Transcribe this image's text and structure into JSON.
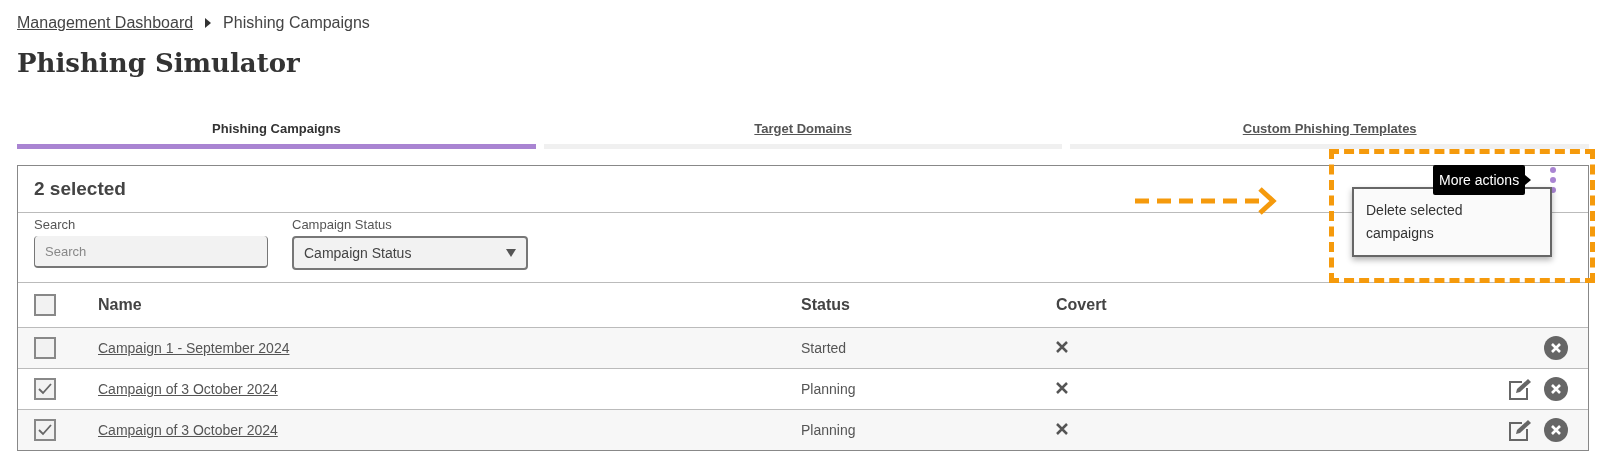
{
  "breadcrumb": [
    {
      "label": "Management Dashboard",
      "link": true
    },
    {
      "label": "Phishing Campaigns",
      "link": false
    }
  ],
  "title": "Phishing Simulator",
  "tabs": [
    {
      "label": "Phishing Campaigns",
      "selected": true
    },
    {
      "label": "Target Domains",
      "selected": false
    },
    {
      "label": "Custom Phishing Templates",
      "selected": false
    }
  ],
  "selection_summary": "2 selected",
  "more_actions": {
    "tooltip": "More actions",
    "menu_items": [
      "Delete selected campaigns"
    ]
  },
  "filters": {
    "search": {
      "label": "Search",
      "placeholder": "Search"
    },
    "status": {
      "label": "Campaign Status",
      "value": "Campaign Status"
    }
  },
  "table": {
    "select_all_checked": false,
    "columns": [
      "Name",
      "Status",
      "Covert"
    ],
    "rows": [
      {
        "checked": false,
        "name": "Campaign 1 - September 2024",
        "status": "Started",
        "covert": false,
        "editable": false
      },
      {
        "checked": true,
        "name": "Campaign of 3 October 2024",
        "status": "Planning",
        "covert": false,
        "editable": true
      },
      {
        "checked": true,
        "name": "Campaign of 3 October 2024",
        "status": "Planning",
        "covert": false,
        "editable": true
      }
    ]
  }
}
